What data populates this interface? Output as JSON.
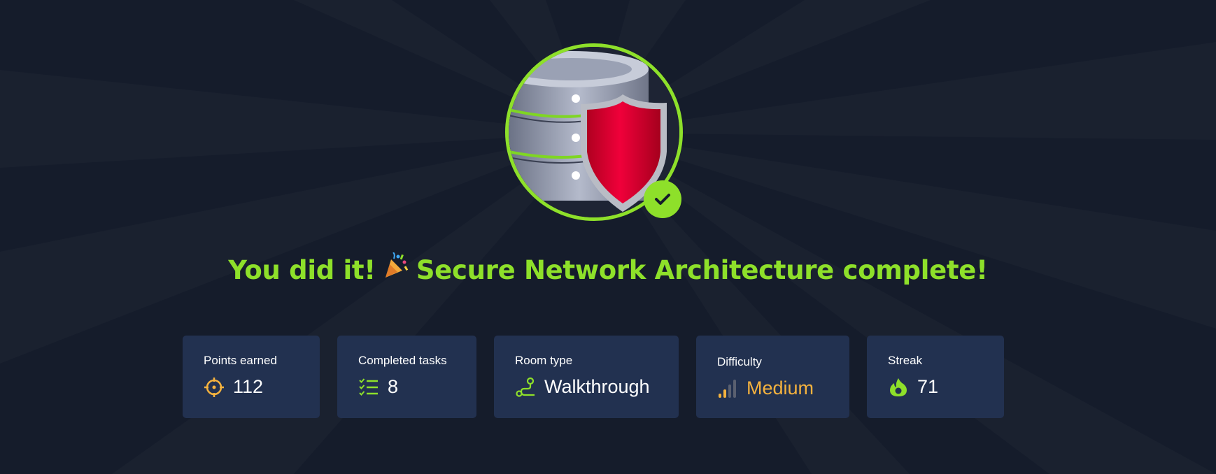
{
  "headline": {
    "before": "You did it!",
    "after": "Secure Network Architecture complete!",
    "emoji": "🎉"
  },
  "badge": {
    "icon": "database-shield-icon",
    "completed_icon": "checkmark-icon"
  },
  "stats": [
    {
      "label": "Points earned",
      "value": "112",
      "icon": "target-icon"
    },
    {
      "label": "Completed tasks",
      "value": "8",
      "icon": "task-list-icon"
    },
    {
      "label": "Room type",
      "value": "Walkthrough",
      "icon": "route-icon"
    },
    {
      "label": "Difficulty",
      "value": "Medium",
      "icon": "signal-bars-icon"
    },
    {
      "label": "Streak",
      "value": "71",
      "icon": "flame-icon"
    }
  ],
  "colors": {
    "background": "#151c2b",
    "accent": "#8ee02a",
    "card": "#223150",
    "difficulty": "#f5b23e",
    "shield": "#e0002e"
  }
}
